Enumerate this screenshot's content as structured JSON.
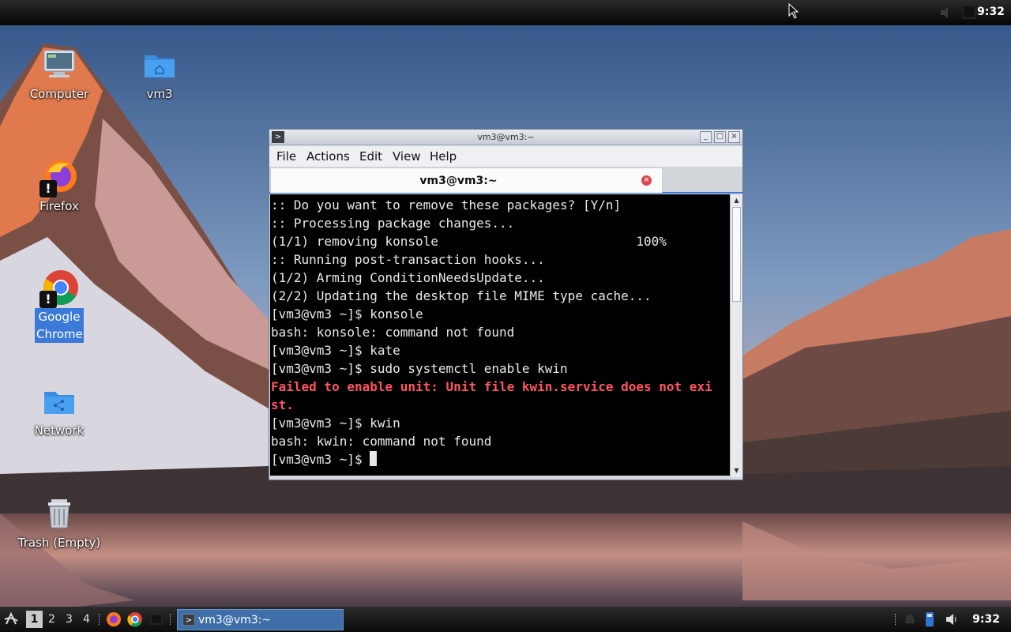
{
  "top_panel": {
    "clock": "9:32"
  },
  "desktop_icons": [
    {
      "label": "Computer",
      "icon": "computer-icon"
    },
    {
      "label": "vm3",
      "icon": "home-folder-icon"
    },
    {
      "label": "Firefox",
      "icon": "firefox-icon"
    },
    {
      "label": "Google Chrome",
      "icon": "chrome-icon",
      "selected": true
    },
    {
      "label": "Network",
      "icon": "network-folder-icon"
    },
    {
      "label": "Trash (Empty)",
      "icon": "trash-icon"
    }
  ],
  "window": {
    "title": "vm3@vm3:~",
    "menu": [
      "File",
      "Actions",
      "Edit",
      "View",
      "Help"
    ],
    "tab_label": "vm3@vm3:~",
    "terminal_lines": [
      {
        "text": ":: Do you want to remove these packages? [Y/n]"
      },
      {
        "text": ":: Processing package changes..."
      },
      {
        "text": "(1/1) removing konsole                          100%"
      },
      {
        "text": ":: Running post-transaction hooks..."
      },
      {
        "text": "(1/2) Arming ConditionNeedsUpdate..."
      },
      {
        "text": "(2/2) Updating the desktop file MIME type cache..."
      },
      {
        "text": "[vm3@vm3 ~]$ konsole"
      },
      {
        "text": "bash: konsole: command not found"
      },
      {
        "text": "[vm3@vm3 ~]$ kate"
      },
      {
        "text": "[vm3@vm3 ~]$ sudo systemctl enable kwin"
      },
      {
        "text": "Failed to enable unit: Unit file kwin.service does not exi",
        "error": true
      },
      {
        "text": "st.",
        "error": true
      },
      {
        "text": "[vm3@vm3 ~]$ kwin"
      },
      {
        "text": "bash: kwin: command not found"
      }
    ],
    "prompt": "[vm3@vm3 ~]$ "
  },
  "taskbar": {
    "workspaces": [
      "1",
      "2",
      "3",
      "4"
    ],
    "active_workspace": "1",
    "task_label": "vm3@vm3:~",
    "clock": "9:32"
  },
  "colors": {
    "terminal_bg": "#000000",
    "terminal_fg": "#e9e9e9",
    "error_fg": "#ff5460",
    "accent": "#3b7ad9"
  }
}
